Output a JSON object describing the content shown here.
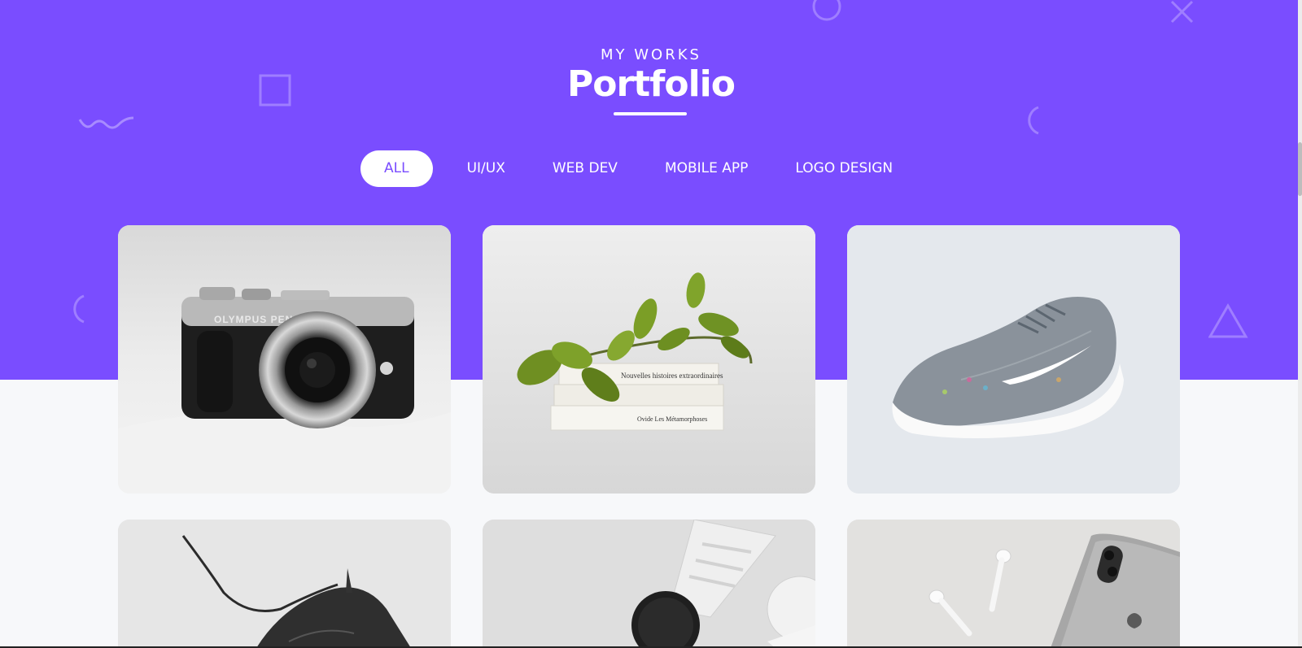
{
  "section": {
    "eyebrow": "MY WORKS",
    "title": "Portfolio"
  },
  "filters": {
    "all": "ALL",
    "uiux": "UI/UX",
    "webdev": "WEB DEV",
    "mobile": "MOBILE APP",
    "logo": "LOGO DESIGN",
    "active": "ALL"
  },
  "gallery": {
    "items": [
      {
        "subject": "camera",
        "brand_text": "OLYMPUS PEN"
      },
      {
        "subject": "books-with-plant",
        "book_titles": [
          "Nouvelles histoires extraordinaires",
          "Ovide  Les Métamorphoses"
        ]
      },
      {
        "subject": "sneaker"
      },
      {
        "subject": "sneaker-laces"
      },
      {
        "subject": "smartwatch"
      },
      {
        "subject": "earbuds-and-phone"
      }
    ]
  },
  "colors": {
    "accent": "#7a4dff",
    "background": "#f7f8fa",
    "white": "#ffffff"
  }
}
